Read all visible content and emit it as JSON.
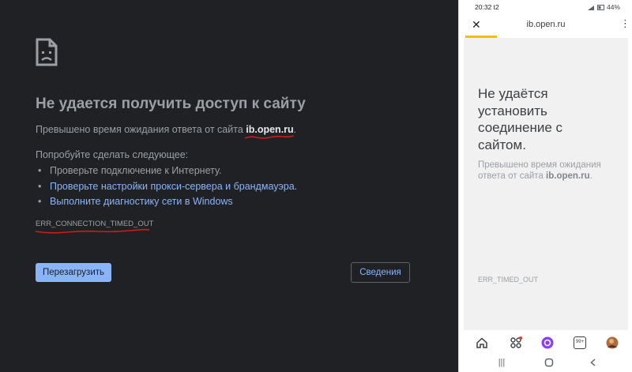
{
  "desktop": {
    "title": "Не удается получить доступ к сайту",
    "subtitle_prefix": "Превышено время ожидания ответа от сайта ",
    "host": "ib.open.ru",
    "subtitle_suffix": ".",
    "try_label": "Попробуйте сделать следующее:",
    "suggestions": [
      "Проверьте подключение к Интернету.",
      "Проверьте настройки прокси-сервера и брандмауэра.",
      "Выполните диагностику сети в Windows"
    ],
    "error_code": "ERR_CONNECTION_TIMED_OUT",
    "reload_label": "Перезагрузить",
    "details_label": "Сведения"
  },
  "phone": {
    "status": {
      "time": "20:32",
      "carrier": "t2",
      "battery": "44%"
    },
    "url": "ib.open.ru",
    "title": "Не удаётся установить соединение с сайтом.",
    "subtitle_prefix": "Превышено время ожидания ответа от сайта ",
    "host": "ib.open.ru",
    "subtitle_suffix": ".",
    "error_code": "ERR_TIMED_OUT",
    "nav_icons": [
      "home-icon",
      "apps-icon",
      "assistant-icon",
      "tabs-icon",
      "profile-icon"
    ],
    "tabs_count": "99+"
  },
  "colors": {
    "desktop_bg": "#202124",
    "accent_blue": "#8ab4f8",
    "annotation_red": "#d11a1a",
    "progress_yellow": "#fbbc04",
    "assistant_purple": "#8b3dff"
  }
}
